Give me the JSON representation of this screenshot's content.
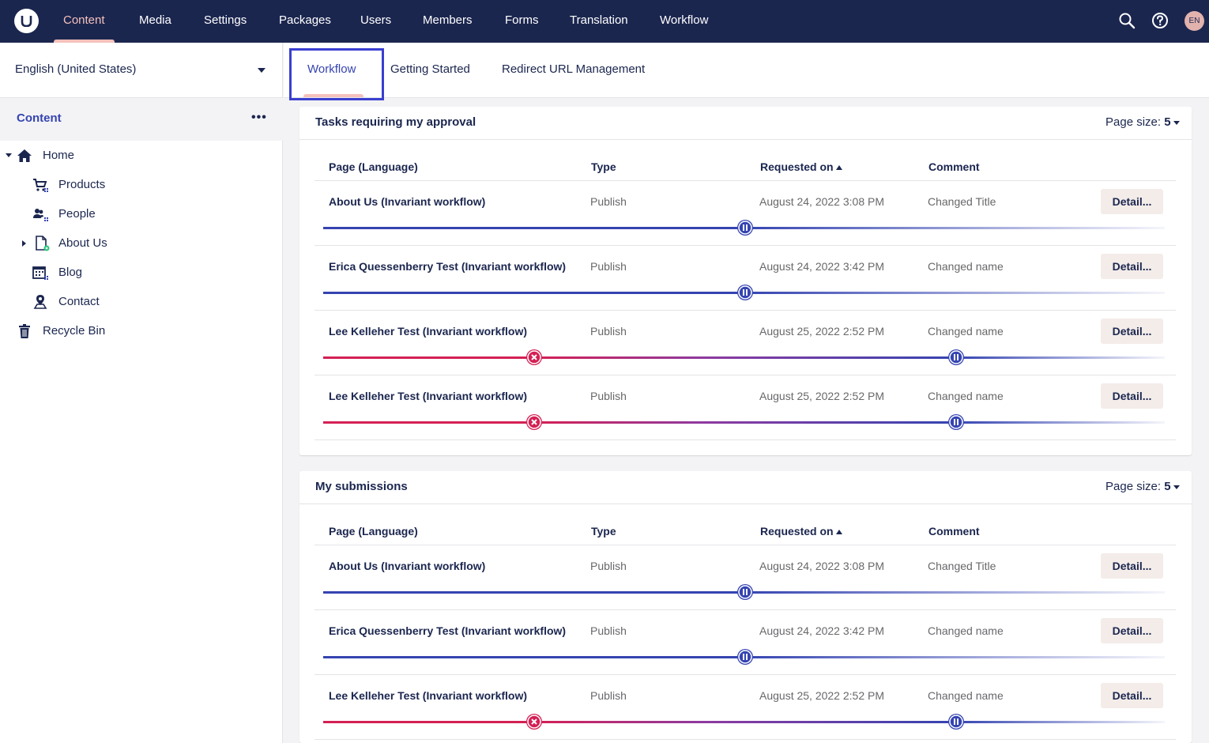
{
  "topnav": {
    "items": [
      "Content",
      "Media",
      "Settings",
      "Packages",
      "Users",
      "Members",
      "Forms",
      "Translation",
      "Workflow"
    ],
    "active": "Content",
    "icons": [
      "search-icon",
      "help-icon"
    ],
    "avatar": "EN"
  },
  "sidebar": {
    "language": "English (United States)",
    "title": "Content",
    "more": "•••",
    "tree": [
      {
        "label": "Home",
        "icon": "home-icon"
      },
      {
        "label": "Products",
        "icon": "shopping-cart-icon"
      },
      {
        "label": "People",
        "icon": "people-icon"
      },
      {
        "label": "About Us",
        "icon": "document-icon"
      },
      {
        "label": "Blog",
        "icon": "calendar-icon"
      },
      {
        "label": "Contact",
        "icon": "map-pin-icon"
      },
      {
        "label": "Recycle Bin",
        "icon": "trash-icon"
      }
    ]
  },
  "tabs": [
    "Workflow",
    "Getting Started",
    "Redirect URL Management"
  ],
  "colors": {
    "nav_bg": "#1b264f",
    "accent_pink": "#f5c1bc",
    "progress_blue": "#3544b1",
    "progress_red": "#d42054",
    "highlight": "#3a3fcf"
  },
  "approval": {
    "title": "Tasks requiring my approval",
    "page_size_label": "Page size:",
    "page_size": "5",
    "headers": [
      "Page (Language)",
      "Type",
      "Requested on",
      "Comment"
    ],
    "rows": [
      {
        "page": "About Us (Invariant workflow)",
        "type": "Publish",
        "date": "August 24, 2022 3:08 PM",
        "comment": "Changed Title",
        "button": "Detail...",
        "status": "in-progress"
      },
      {
        "page": "Erica Quessenberry Test (Invariant workflow)",
        "type": "Publish",
        "date": "August 24, 2022 3:42 PM",
        "comment": "Changed name",
        "button": "Detail...",
        "status": "in-progress"
      },
      {
        "page": "Lee Kelleher Test (Invariant workflow)",
        "type": "Publish",
        "date": "August 25, 2022 2:52 PM",
        "comment": "Changed name",
        "button": "Detail...",
        "status": "rejected-then-pending"
      },
      {
        "page": "Lee Kelleher Test (Invariant workflow)",
        "type": "Publish",
        "date": "August 25, 2022 2:52 PM",
        "comment": "Changed name",
        "button": "Detail...",
        "status": "rejected-then-pending"
      }
    ]
  },
  "submissions": {
    "title": "My submissions",
    "page_size_label": "Page size:",
    "page_size": "5",
    "headers": [
      "Page (Language)",
      "Type",
      "Requested on",
      "Comment"
    ],
    "rows": [
      {
        "page": "About Us (Invariant workflow)",
        "type": "Publish",
        "date": "August 24, 2022 3:08 PM",
        "comment": "Changed Title",
        "button": "Detail...",
        "status": "in-progress"
      },
      {
        "page": "Erica Quessenberry Test (Invariant workflow)",
        "type": "Publish",
        "date": "August 24, 2022 3:42 PM",
        "comment": "Changed name",
        "button": "Detail...",
        "status": "in-progress"
      },
      {
        "page": "Lee Kelleher Test (Invariant workflow)",
        "type": "Publish",
        "date": "August 25, 2022 2:52 PM",
        "comment": "Changed name",
        "button": "Detail...",
        "status": "rejected-then-pending"
      }
    ]
  }
}
